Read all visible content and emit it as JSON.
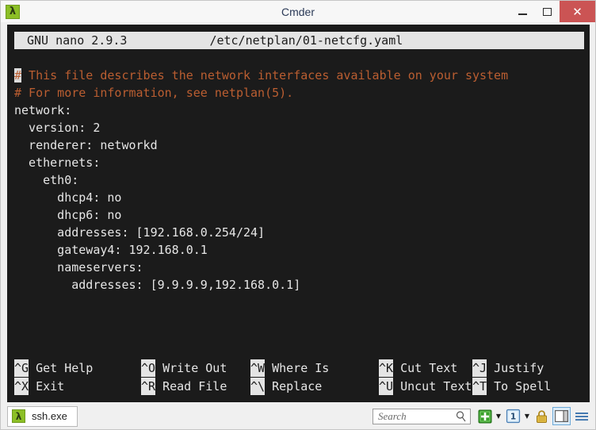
{
  "window": {
    "title": "Cmder",
    "app_icon": "lambda-icon",
    "controls": {
      "minimize": "minimize-icon",
      "maximize": "maximize-icon",
      "close": "✕"
    }
  },
  "nano": {
    "header": {
      "version": "GNU nano 2.9.3",
      "filename": "/etc/netplan/01-netcfg.yaml"
    },
    "cursor_char": "#",
    "lines": [
      {
        "text": "# This file describes the network interfaces available on your system",
        "type": "comment",
        "cursor": true
      },
      {
        "text": "# For more information, see netplan(5).",
        "type": "comment",
        "cursor": false
      },
      {
        "text": "network:",
        "type": "code",
        "cursor": false
      },
      {
        "text": "  version: 2",
        "type": "code",
        "cursor": false
      },
      {
        "text": "  renderer: networkd",
        "type": "code",
        "cursor": false
      },
      {
        "text": "  ethernets:",
        "type": "code",
        "cursor": false
      },
      {
        "text": "    eth0:",
        "type": "code",
        "cursor": false
      },
      {
        "text": "      dhcp4: no",
        "type": "code",
        "cursor": false
      },
      {
        "text": "      dhcp6: no",
        "type": "code",
        "cursor": false
      },
      {
        "text": "      addresses: [192.168.0.254/24]",
        "type": "code",
        "cursor": false
      },
      {
        "text": "      gateway4: 192.168.0.1",
        "type": "code",
        "cursor": false
      },
      {
        "text": "      nameservers:",
        "type": "code",
        "cursor": false
      },
      {
        "text": "        addresses: [9.9.9.9,192.168.0.1]",
        "type": "code",
        "cursor": false
      }
    ],
    "shortcuts_row1": [
      {
        "key": "^G",
        "label": " Get Help"
      },
      {
        "key": "^O",
        "label": " Write Out"
      },
      {
        "key": "^W",
        "label": " Where Is"
      },
      {
        "key": "^K",
        "label": " Cut Text"
      },
      {
        "key": "^J",
        "label": " Justify"
      }
    ],
    "shortcuts_row2": [
      {
        "key": "^X",
        "label": " Exit"
      },
      {
        "key": "^R",
        "label": " Read File"
      },
      {
        "key": "^\\",
        "label": " Replace"
      },
      {
        "key": "^U",
        "label": " Uncut Text"
      },
      {
        "key": "^T",
        "label": " To Spell"
      }
    ]
  },
  "bottom_bar": {
    "tabs": [
      {
        "label": "ssh.exe",
        "icon": "lambda-icon",
        "active": true
      }
    ],
    "search": {
      "placeholder": "Search",
      "value": "",
      "icon": "search-icon"
    },
    "toolbar_icons": [
      "new-tab-plus-icon",
      "new-tab-dropdown-chevron-icon",
      "new-console-icon",
      "new-console-dropdown-chevron-icon",
      "lock-icon",
      "toggle-panel-icon",
      "main-menu-icon"
    ],
    "new_console_number": "1"
  },
  "colors": {
    "terminal_bg": "#1b1b1b",
    "terminal_fg": "#e6e6e6",
    "comment": "#bb5e31",
    "inverse_bg": "#e4e4e4",
    "accent_green": "#8cbf26",
    "close_red": "#cb5454",
    "panel_highlight": "#6ca9d8"
  }
}
